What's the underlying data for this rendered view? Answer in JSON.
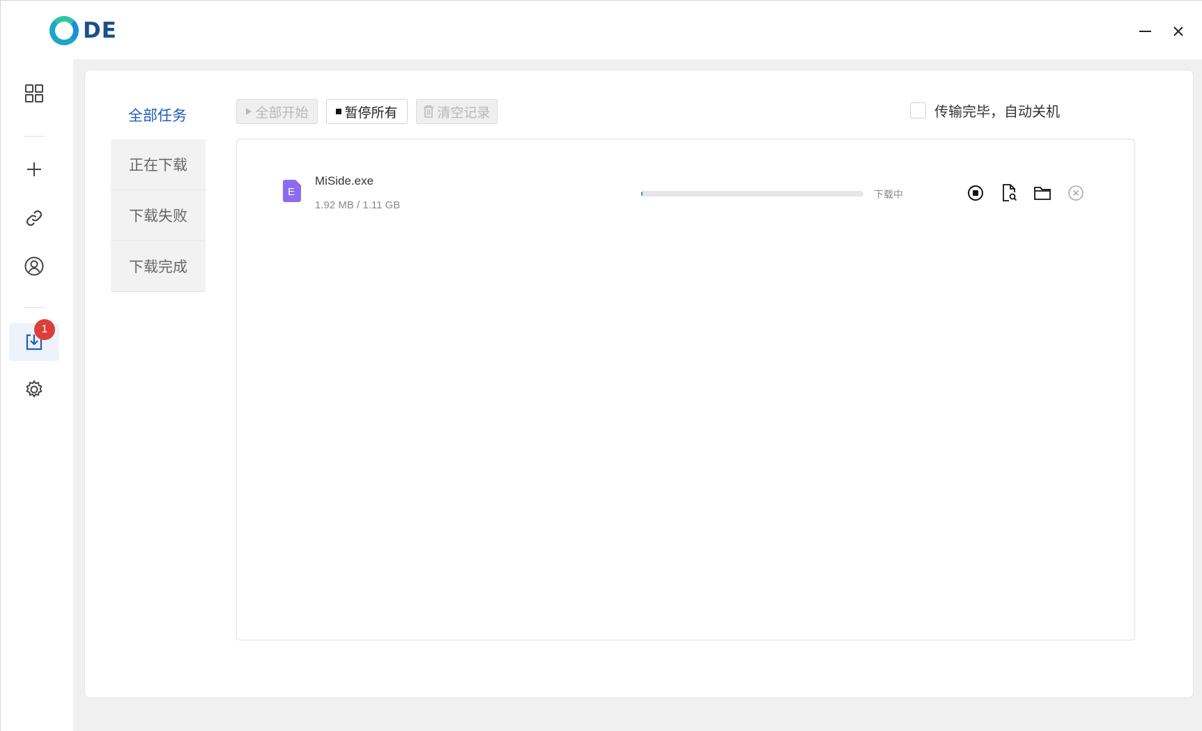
{
  "app": {
    "logo_text": "DE"
  },
  "window_controls": {
    "minimize_icon": "minimize-icon",
    "close_icon": "close-icon"
  },
  "rail": {
    "items": [
      {
        "icon": "apps-grid-icon"
      },
      {
        "icon": "plus-icon"
      },
      {
        "icon": "link-icon"
      },
      {
        "icon": "user-circle-icon"
      },
      {
        "icon": "download-box-icon",
        "badge": "1",
        "active": true
      },
      {
        "icon": "gear-icon"
      }
    ]
  },
  "categories": {
    "all": "全部任务",
    "items": [
      {
        "label": "正在下载"
      },
      {
        "label": "下载失败"
      },
      {
        "label": "下载完成"
      }
    ]
  },
  "toolbar": {
    "start_all": "全部开始",
    "pause_all": "暂停所有",
    "clear_records": "清空记录"
  },
  "auto_shutdown": {
    "label": "传输完毕，自动关机",
    "checked": false
  },
  "tasks": [
    {
      "file_icon_letter": "E",
      "name": "MiSide.exe",
      "size": "1.92 MB / 1.11 GB",
      "progress": 0.0017,
      "status": "下载中"
    }
  ],
  "colors": {
    "accent": "#1f5db8",
    "badge": "#d9403a",
    "file_icon": "#8b6cf0",
    "progress": "#3a7ae0"
  }
}
